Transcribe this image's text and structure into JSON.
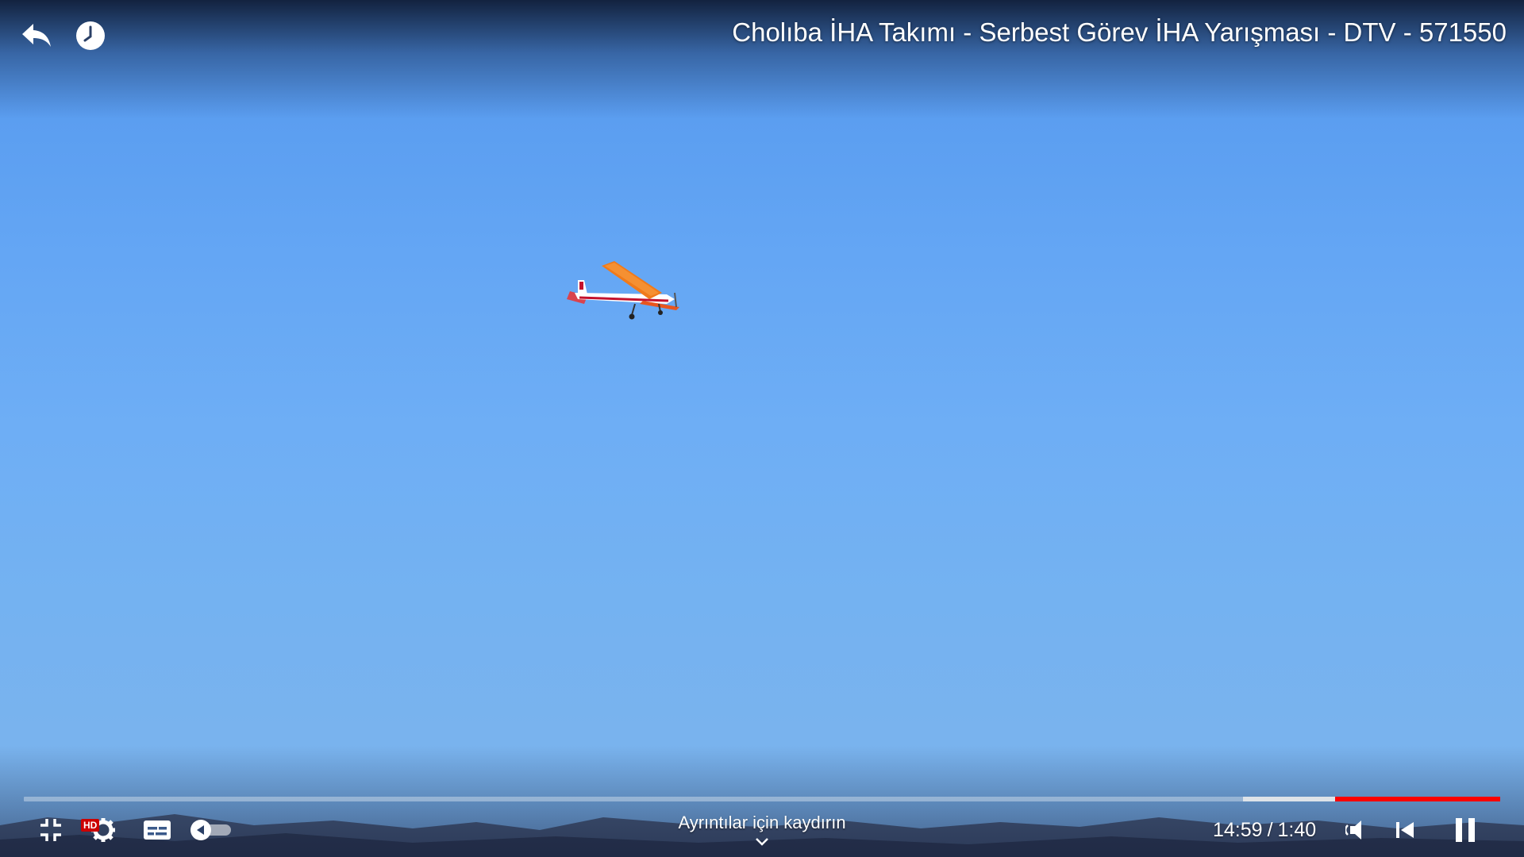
{
  "video": {
    "title": "Cholıba İHA Takımı - Serbest Görev İHA Yarışması - DTV - 571550"
  },
  "top_bar": {
    "back_icon": "reply-arrow-icon",
    "watch_later_icon": "clock-icon"
  },
  "progress": {
    "played_fraction": 0.112,
    "buffered_fraction": 0.174,
    "played_color": "#ff0000"
  },
  "hint": {
    "swipe_text": "Ayrıntılar için kaydırın"
  },
  "time": {
    "current": "1:40",
    "separator": "/",
    "total": "14:59"
  },
  "controls": {
    "hd_badge": "HD",
    "fullscreen_exit_icon": "fullscreen-exit-icon",
    "settings_icon": "gear-icon",
    "captions_icon": "captions-icon",
    "autoplay_icon": "autoplay-toggle-icon",
    "volume_icon": "volume-icon",
    "previous_icon": "skip-previous-icon",
    "pause_icon": "pause-icon"
  },
  "colors": {
    "sky": "#64a6f4",
    "accent": "#ff0000"
  }
}
